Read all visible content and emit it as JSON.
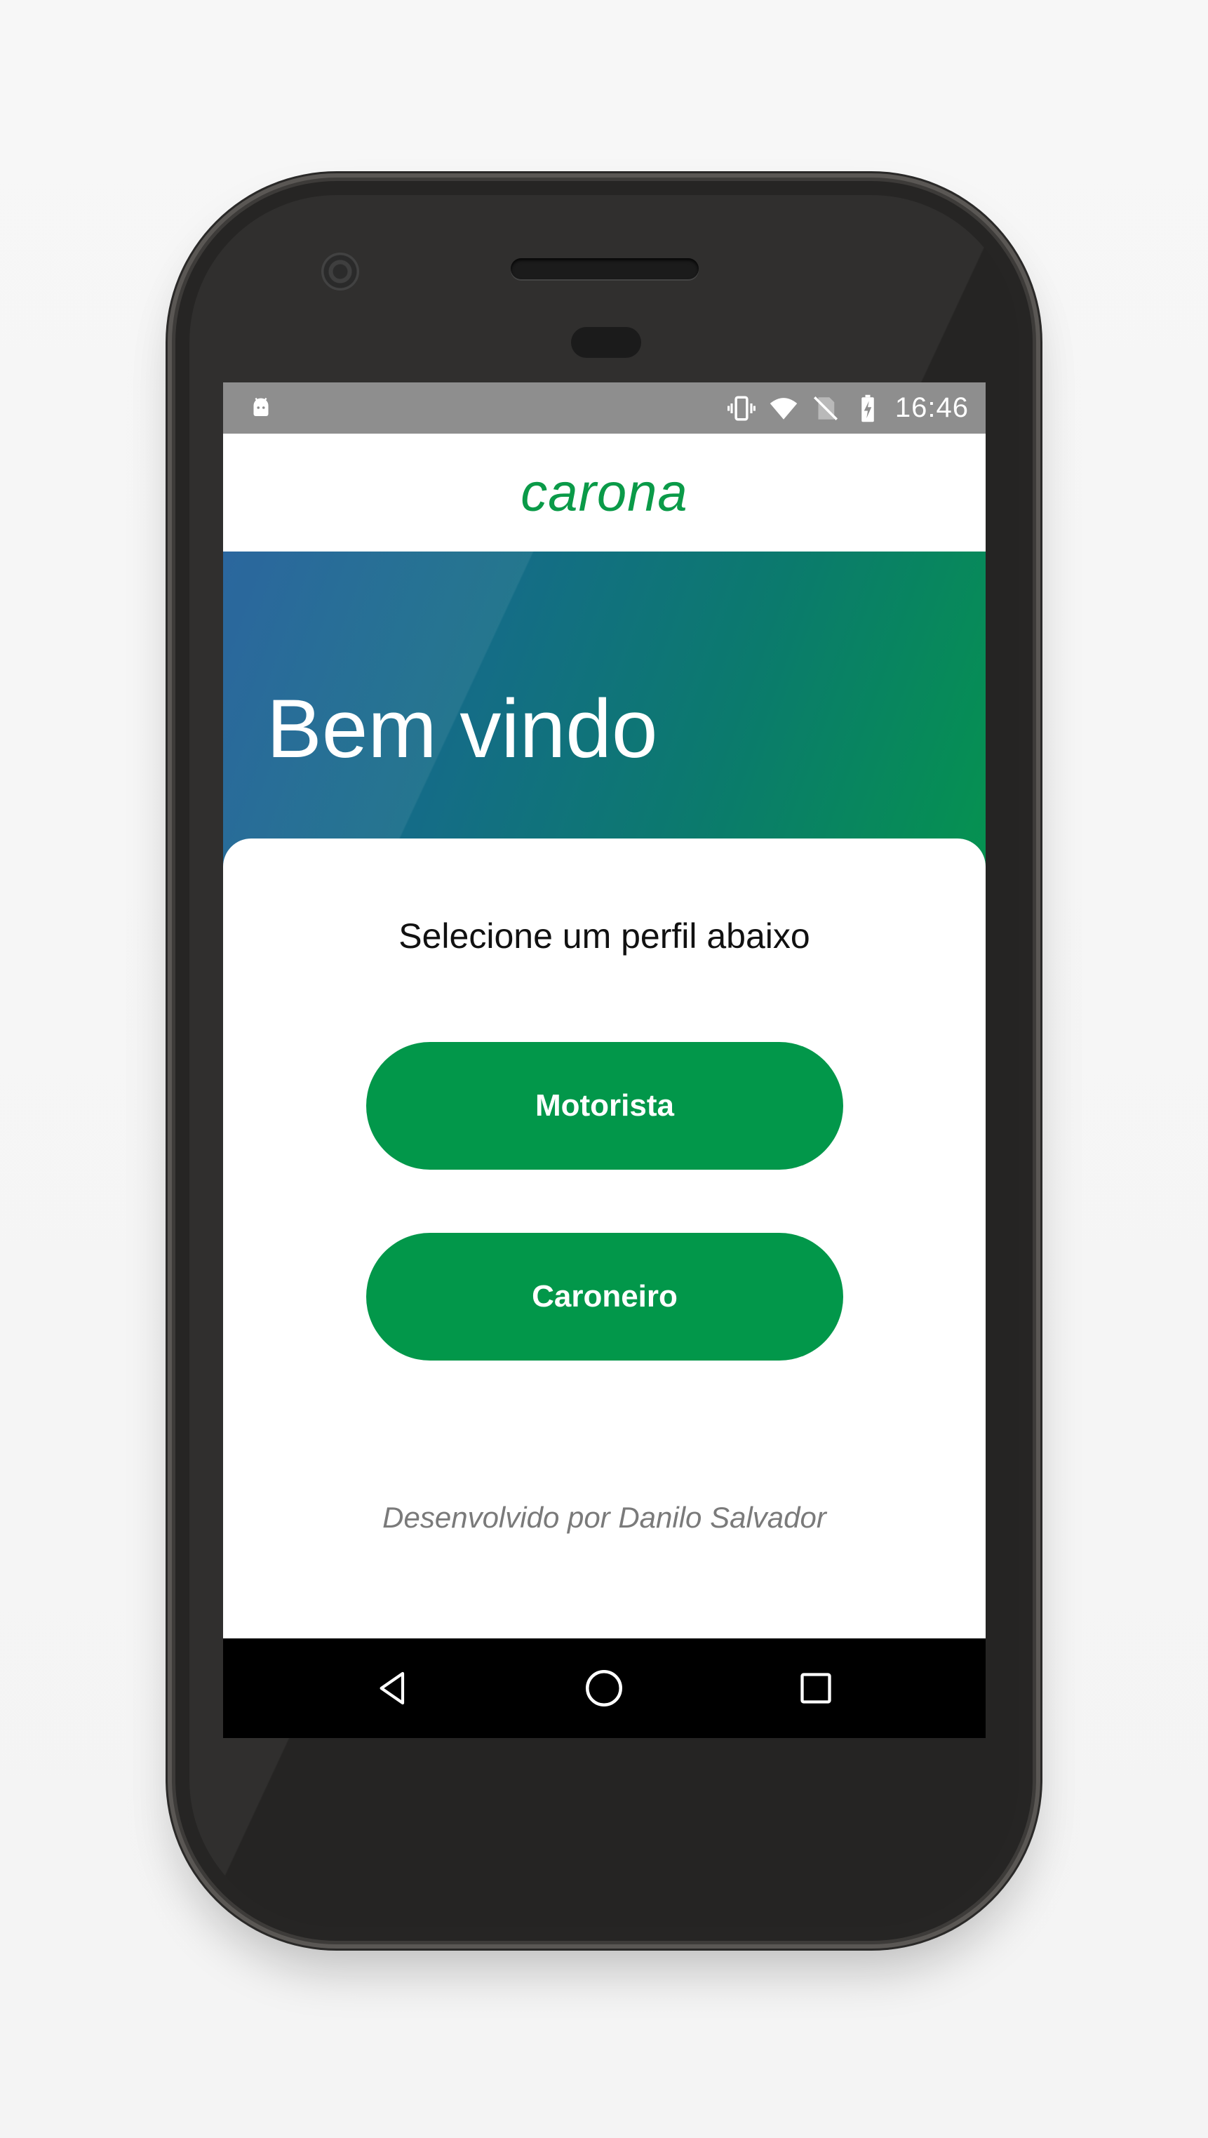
{
  "status_bar": {
    "time": "16:46",
    "icons": [
      "android-debug-icon",
      "vibrate-icon",
      "wifi-icon",
      "no-sim-icon",
      "battery-charging-icon"
    ]
  },
  "app_bar": {
    "title": "carona",
    "title_color": "#0a9a48"
  },
  "hero": {
    "title": "Bem vindo",
    "gradient_colors": [
      "#1b5b97",
      "#059250"
    ]
  },
  "main": {
    "subtitle": "Selecione um perfil abaixo",
    "buttons": [
      {
        "label": "Motorista"
      },
      {
        "label": "Caroneiro"
      }
    ],
    "button_color": "#02974a",
    "footer": "Desenvolvido por Danilo Salvador"
  },
  "nav_bar": {
    "buttons": [
      "back-icon",
      "home-icon",
      "recents-icon"
    ]
  }
}
